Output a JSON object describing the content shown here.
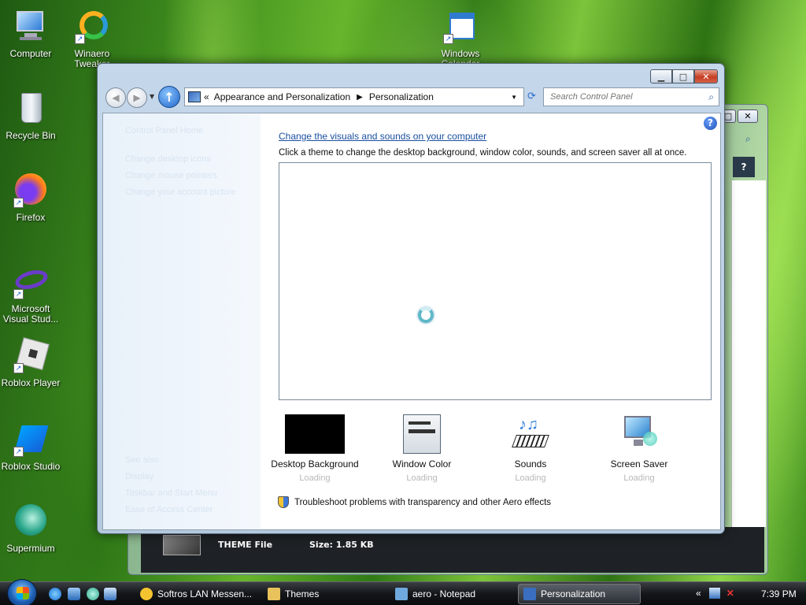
{
  "desktop_icons": [
    {
      "label": "Computer",
      "icon": "computer-icon",
      "shortcut": false
    },
    {
      "label": "Winaero Tweaker",
      "icon": "winaero-icon",
      "shortcut": true
    },
    {
      "label": "Windows Calendar",
      "icon": "calendar-icon",
      "shortcut": true
    },
    {
      "label": "Recycle Bin",
      "icon": "recycle-bin-icon",
      "shortcut": false
    },
    {
      "label": "Firefox",
      "icon": "firefox-icon",
      "shortcut": true
    },
    {
      "label": "Microsoft Visual Stud...",
      "icon": "visual-studio-icon",
      "shortcut": true
    },
    {
      "label": "Roblox Player",
      "icon": "roblox-icon",
      "shortcut": true
    },
    {
      "label": "Roblox Studio",
      "icon": "roblox-studio-icon",
      "shortcut": true
    },
    {
      "label": "Supermium",
      "icon": "supermium-icon",
      "shortcut": false
    }
  ],
  "background_window": {
    "file_type": "THEME File",
    "file_size": "Size: 1.85 KB"
  },
  "window": {
    "breadcrumb": {
      "overflow": "«",
      "items": [
        "Appearance and Personalization",
        "Personalization"
      ]
    },
    "search_placeholder": "Search Control Panel",
    "left_links": [
      "Control Panel Home",
      "Change desktop icons",
      "Change mouse pointers",
      "Change your account picture",
      "See also",
      "Display",
      "Taskbar and Start Menu",
      "Ease of Access Center"
    ],
    "heading": "Change the visuals and sounds on your computer",
    "subtitle": "Click a theme to change the desktop background, window color, sounds, and screen saver all at once.",
    "tiles": [
      {
        "label": "Desktop Background",
        "status": "Loading"
      },
      {
        "label": "Window Color",
        "status": "Loading"
      },
      {
        "label": "Sounds",
        "status": "Loading"
      },
      {
        "label": "Screen Saver",
        "status": "Loading"
      }
    ],
    "troubleshoot": "Troubleshoot problems with transparency and other Aero effects"
  },
  "taskbar": {
    "buttons": [
      {
        "label": "Softros LAN Messen...",
        "icon_color": "#f4c430",
        "active": false
      },
      {
        "label": "Themes",
        "icon_color": "#e8c25a",
        "active": false
      },
      {
        "label": "aero - Notepad",
        "icon_color": "#6fa8dc",
        "active": false
      },
      {
        "label": "Personalization",
        "icon_color": "#3a6ec0",
        "active": true
      }
    ],
    "tray_overflow": "«",
    "clock": "7:39 PM"
  },
  "colors": {
    "link": "#1a4fa0",
    "status": "#b8b8b8",
    "close_button": "#c53c22"
  }
}
